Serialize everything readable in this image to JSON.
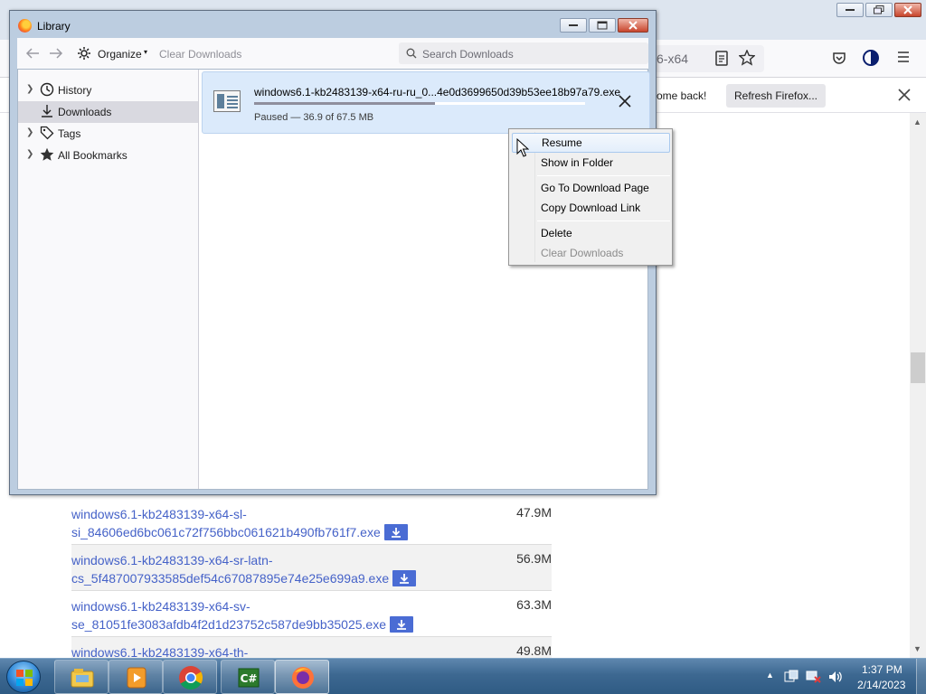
{
  "background_browser": {
    "url_fragment": "6-x64",
    "notification": {
      "message": "come back!",
      "refresh_button": "Refresh Firefox..."
    },
    "downloads_table": [
      {
        "name": "windows6.1-kb2483139-x64-sl-si_84606ed6bc061c72f756bbc061621b490fb761f7.exe",
        "line1": "windows6.1-kb2483139-x64-sl-",
        "line2": "si_84606ed6bc061c72f756bbc061621b490fb761f7.exe",
        "size": "47.9M"
      },
      {
        "name": "windows6.1-kb2483139-x64-sr-latn-cs_5f487007933585def54c67087895e74e25e699a9.exe",
        "line1": "windows6.1-kb2483139-x64-sr-latn-",
        "line2": "cs_5f487007933585def54c67087895e74e25e699a9.exe",
        "size": "56.9M"
      },
      {
        "name": "windows6.1-kb2483139-x64-sv-se_81051fe3083afdb4f2d1d23752c587de9bb35025.exe",
        "line1": "windows6.1-kb2483139-x64-sv-",
        "line2": "se_81051fe3083afdb4f2d1d23752c587de9bb35025.exe",
        "size": "63.3M"
      },
      {
        "name": "windows6.1-kb2483139-x64-th-",
        "line1": "windows6.1-kb2483139-x64-th-",
        "line2": "",
        "size": "49.8M"
      }
    ]
  },
  "library": {
    "title": "Library",
    "toolbar": {
      "organize": "Organize",
      "clear_downloads": "Clear Downloads",
      "search_placeholder": "Search Downloads"
    },
    "sidebar": {
      "items": [
        {
          "label": "History",
          "icon": "clock-icon",
          "expandable": true,
          "selected": false
        },
        {
          "label": "Downloads",
          "icon": "download-icon",
          "expandable": false,
          "selected": true
        },
        {
          "label": "Tags",
          "icon": "tag-icon",
          "expandable": true,
          "selected": false
        },
        {
          "label": "All Bookmarks",
          "icon": "star-icon",
          "expandable": true,
          "selected": false
        }
      ]
    },
    "download": {
      "filename": "windows6.1-kb2483139-x64-ru-ru_0...4e0d3699650d39b53ee18b97a79.exe",
      "status": "Paused — 36.9 of 67.5 MB",
      "progress": 0.547
    }
  },
  "context_menu": {
    "items": [
      {
        "label": "Resume",
        "hover": true,
        "disabled": false
      },
      {
        "label": "Show in Folder",
        "hover": false,
        "disabled": false
      },
      {
        "label": "Go To Download Page",
        "hover": false,
        "disabled": false
      },
      {
        "label": "Copy Download Link",
        "hover": false,
        "disabled": false
      },
      {
        "label": "Delete",
        "hover": false,
        "disabled": false
      },
      {
        "label": "Clear Downloads",
        "hover": false,
        "disabled": true
      }
    ]
  },
  "taskbar": {
    "time": "1:37 PM",
    "date": "2/14/2023"
  },
  "colors": {
    "accent_link": "#4562c8",
    "download_item_bg": "#dbeafb",
    "taskbar": "#3d6891"
  }
}
